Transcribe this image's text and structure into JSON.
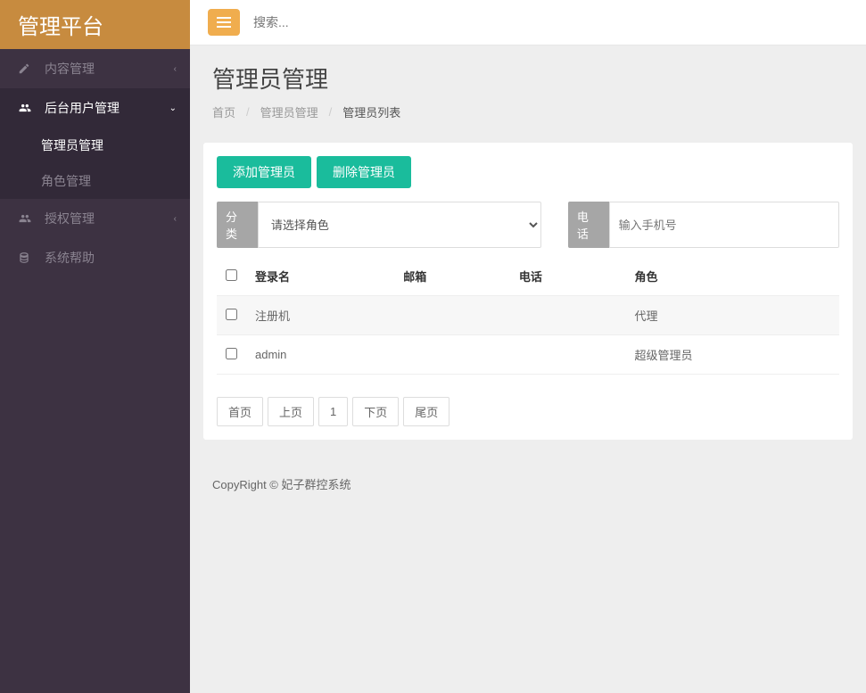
{
  "brand": "管理平台",
  "search": {
    "placeholder": "搜索..."
  },
  "sidebar": {
    "items": [
      {
        "label": "内容管理",
        "icon": "edit"
      },
      {
        "label": "后台用户管理",
        "icon": "users",
        "open": true,
        "children": [
          {
            "label": "管理员管理",
            "active": true
          },
          {
            "label": "角色管理"
          }
        ]
      },
      {
        "label": "授权管理",
        "icon": "users"
      },
      {
        "label": "系统帮助",
        "icon": "database"
      }
    ]
  },
  "page": {
    "title": "管理员管理",
    "breadcrumb": [
      "首页",
      "管理员管理",
      "管理员列表"
    ]
  },
  "actions": {
    "add": "添加管理员",
    "delete": "删除管理员"
  },
  "filters": {
    "role_label": "分类",
    "role_placeholder": "请选择角色",
    "phone_label": "电话",
    "phone_placeholder": "输入手机号"
  },
  "table": {
    "headers": [
      "登录名",
      "邮箱",
      "电话",
      "角色"
    ],
    "rows": [
      {
        "login": "注册机",
        "email": "",
        "phone": "",
        "role": "代理"
      },
      {
        "login": "admin",
        "email": "",
        "phone": "",
        "role": "超级管理员"
      }
    ]
  },
  "pagination": {
    "first": "首页",
    "prev": "上页",
    "current": "1",
    "next": "下页",
    "last": "尾页"
  },
  "footer": "CopyRight © 妃子群控系统"
}
